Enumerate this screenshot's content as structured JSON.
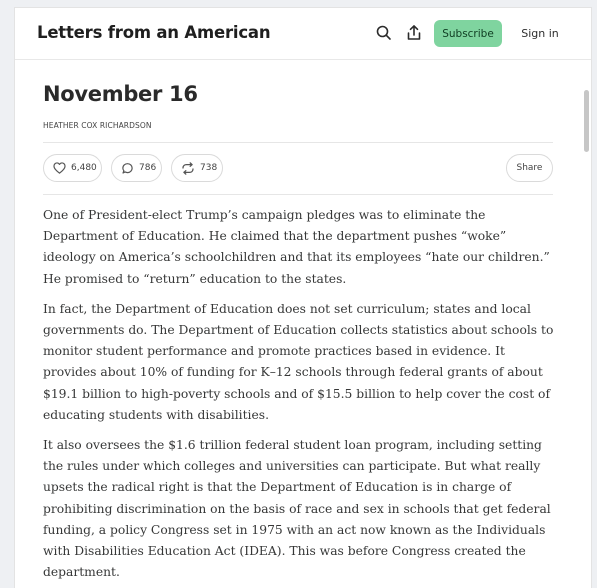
{
  "header": {
    "publication_title": "Letters from an American",
    "subscribe_label": "Subscribe",
    "signin_label": "Sign in",
    "search_icon": "search-icon",
    "share_icon": "share-icon"
  },
  "post": {
    "title": "November 16",
    "author": "HEATHER COX RICHARDSON",
    "likes": "6,480",
    "comments": "786",
    "restacks": "738",
    "share_label": "Share",
    "paragraphs": [
      "One of President-elect Trump’s campaign pledges was to eliminate the Department of Education. He claimed that the department pushes “woke” ideology on America’s schoolchildren and that its employees “hate our children.” He promised to “return” education to the states.",
      "In fact, the Department of Education does not set curriculum; states and local governments do. The Department of Education collects statistics about schools to monitor student performance and promote practices based in evidence. It provides about 10% of funding for K–12 schools through federal grants of about $19.1 billion to high-poverty schools and of $15.5 billion to help cover the cost of educating students with disabilities.",
      "It also oversees the $1.6 trillion federal student loan program, including setting the rules under which colleges and universities can participate. But what really upsets the radical right is that the Department of Education is in charge of prohibiting discrimination on the basis of race and sex in schools that get federal funding, a policy Congress set in 1975 with an act now known as the Individuals with Disabilities Education Act (IDEA). This was before Congress created the department."
    ]
  },
  "colors": {
    "subscribe_bg": "#7fd49f",
    "page_bg": "#eef0f3",
    "text": "#363737"
  }
}
